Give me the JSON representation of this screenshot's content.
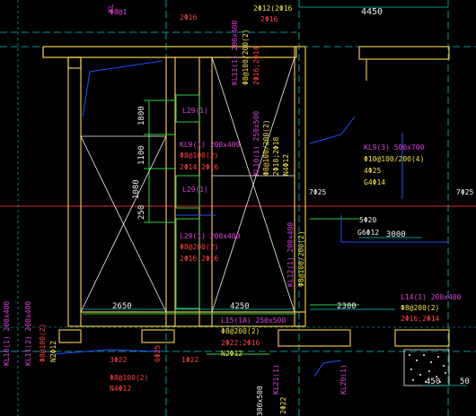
{
  "colors": {
    "bg": "#000000",
    "wall": "#e8c24a",
    "dim": "#00c8c8",
    "beam_dash": "#3aa0ff",
    "axis": "#e03030",
    "label_mag": "#e040e0",
    "label_yel": "#f0e040",
    "label_red": "#ff4040",
    "green": "#30d040",
    "white": "#f2f2f2",
    "blue": "#2050ff"
  },
  "labels": {
    "top_kl": "KL",
    "top_steel": "Φ8@1",
    "top_left_2": "2Φ16",
    "top_mid": "2Φ12(2Φ16",
    "top_right_2": "2Φ16",
    "dim_4450": "4450",
    "kl11": "KL11(1) 200x400",
    "kl11_b": "Φ8@100/200(2)",
    "kl11_c": "2Φ16;2Φ14",
    "dim_1800": "1800",
    "dim_1100": "1100",
    "dim_250": "250",
    "dim_1080": "1080",
    "l29_a": "L29(1)",
    "l29_b": "L29(1)",
    "kl9_a": "KL9(1) 200x400",
    "kl9_b": "Φ8@100(2)",
    "kl9_c": "2Φ14;2Φ16",
    "kl10": "KL10(1) 250x500",
    "kl10_b": "Φ8@100/200(2)",
    "kl10_c": "2Φ18;2Φ18",
    "kl10_d": "N4Φ12",
    "kl9r": "KL9(3) 500x700",
    "kl9r_b": "Φ10@100/200(4)",
    "kl9r_c": "4Φ25",
    "kl9r_d": "G4Φ14",
    "bar_725a": "7Φ25",
    "bar_725b": "7Φ25",
    "bar_520": "5Φ20",
    "g6": "G6Φ12",
    "dim_3000": "3000",
    "l29c": "L29(1) 200x400",
    "l29c_b": "Φ8@200(2)",
    "l29c_c": "2Φ16;2Φ16",
    "kl_vert": "KL12(1) 200x400",
    "kl_vert_b": "Φ8@100/200(2)",
    "dim_2650": "2650",
    "dim_4250": "4250",
    "dim_2300": "2300",
    "l14": "L14(1) 200x400",
    "l14_b": "Φ8@200(2)",
    "l14_c": "2Φ16;2Φ14",
    "l15": "L15(1A) 250x500",
    "l15_b": "Φ8@200(2)",
    "l15_c": "2Φ22;2Φ16",
    "l15_d": "N2Φ12",
    "left_kl": "KL10(1) 200x400",
    "left_kl_b": "KL11(2) 200x400",
    "left_n2": "N2Φ12",
    "left_b": "Φ8@100(2)",
    "bottom_3": "3Φ22",
    "bottom_b": "Φ8@100(2)",
    "bottom_n": "N4Φ12",
    "bottom_6": "6Φ25",
    "bottom_122": "1Φ22",
    "bottom_kl1": "KL20(1)",
    "bottom_kl2": "KL21(1)",
    "bottom_dim300": "300x500",
    "bottom_tiny": "2Φ22",
    "dim_450": "450",
    "dim_50": "50"
  }
}
